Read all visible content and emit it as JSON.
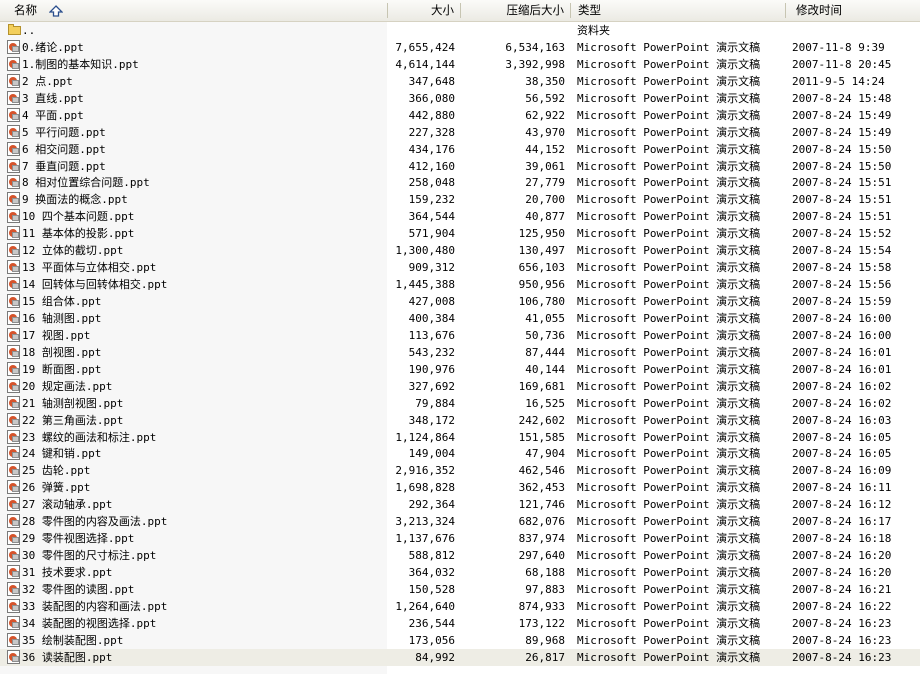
{
  "columns": {
    "name": "名称",
    "size": "大小",
    "compressed": "压缩后大小",
    "type": "类型",
    "modified": "修改时间"
  },
  "parent_row": {
    "name": "..",
    "size": "",
    "compressed": "",
    "type": "资料夹",
    "modified": ""
  },
  "files": [
    {
      "name": "0.绪论.ppt",
      "size": "7,655,424",
      "compressed": "6,534,163",
      "type": "Microsoft PowerPoint 演示文稿",
      "modified": "2007-11-8 9:39"
    },
    {
      "name": "1.制图的基本知识.ppt",
      "size": "4,614,144",
      "compressed": "3,392,998",
      "type": "Microsoft PowerPoint 演示文稿",
      "modified": "2007-11-8 20:45"
    },
    {
      "name": "2 点.ppt",
      "size": "347,648",
      "compressed": "38,350",
      "type": "Microsoft PowerPoint 演示文稿",
      "modified": "2011-9-5 14:24"
    },
    {
      "name": "3 直线.ppt",
      "size": "366,080",
      "compressed": "56,592",
      "type": "Microsoft PowerPoint 演示文稿",
      "modified": "2007-8-24 15:48"
    },
    {
      "name": "4 平面.ppt",
      "size": "442,880",
      "compressed": "62,922",
      "type": "Microsoft PowerPoint 演示文稿",
      "modified": "2007-8-24 15:49"
    },
    {
      "name": "5 平行问题.ppt",
      "size": "227,328",
      "compressed": "43,970",
      "type": "Microsoft PowerPoint 演示文稿",
      "modified": "2007-8-24 15:49"
    },
    {
      "name": "6 相交问题.ppt",
      "size": "434,176",
      "compressed": "44,152",
      "type": "Microsoft PowerPoint 演示文稿",
      "modified": "2007-8-24 15:50"
    },
    {
      "name": "7 垂直问题.ppt",
      "size": "412,160",
      "compressed": "39,061",
      "type": "Microsoft PowerPoint 演示文稿",
      "modified": "2007-8-24 15:50"
    },
    {
      "name": "8 相对位置综合问题.ppt",
      "size": "258,048",
      "compressed": "27,779",
      "type": "Microsoft PowerPoint 演示文稿",
      "modified": "2007-8-24 15:51"
    },
    {
      "name": "9 换面法的概念.ppt",
      "size": "159,232",
      "compressed": "20,700",
      "type": "Microsoft PowerPoint 演示文稿",
      "modified": "2007-8-24 15:51"
    },
    {
      "name": "10 四个基本问题.ppt",
      "size": "364,544",
      "compressed": "40,877",
      "type": "Microsoft PowerPoint 演示文稿",
      "modified": "2007-8-24 15:51"
    },
    {
      "name": "11 基本体的投影.ppt",
      "size": "571,904",
      "compressed": "125,950",
      "type": "Microsoft PowerPoint 演示文稿",
      "modified": "2007-8-24 15:52"
    },
    {
      "name": "12 立体的截切.ppt",
      "size": "1,300,480",
      "compressed": "130,497",
      "type": "Microsoft PowerPoint 演示文稿",
      "modified": "2007-8-24 15:54"
    },
    {
      "name": "13 平面体与立体相交.ppt",
      "size": "909,312",
      "compressed": "656,103",
      "type": "Microsoft PowerPoint 演示文稿",
      "modified": "2007-8-24 15:58"
    },
    {
      "name": "14 回转体与回转体相交.ppt",
      "size": "1,445,388",
      "compressed": "950,956",
      "type": "Microsoft PowerPoint 演示文稿",
      "modified": "2007-8-24 15:56"
    },
    {
      "name": "15 组合体.ppt",
      "size": "427,008",
      "compressed": "106,780",
      "type": "Microsoft PowerPoint 演示文稿",
      "modified": "2007-8-24 15:59"
    },
    {
      "name": "16 轴测图.ppt",
      "size": "400,384",
      "compressed": "41,055",
      "type": "Microsoft PowerPoint 演示文稿",
      "modified": "2007-8-24 16:00"
    },
    {
      "name": "17 视图.ppt",
      "size": "113,676",
      "compressed": "50,736",
      "type": "Microsoft PowerPoint 演示文稿",
      "modified": "2007-8-24 16:00"
    },
    {
      "name": "18 剖视图.ppt",
      "size": "543,232",
      "compressed": "87,444",
      "type": "Microsoft PowerPoint 演示文稿",
      "modified": "2007-8-24 16:01"
    },
    {
      "name": "19 断面图.ppt",
      "size": "190,976",
      "compressed": "40,144",
      "type": "Microsoft PowerPoint 演示文稿",
      "modified": "2007-8-24 16:01"
    },
    {
      "name": "20 规定画法.ppt",
      "size": "327,692",
      "compressed": "169,681",
      "type": "Microsoft PowerPoint 演示文稿",
      "modified": "2007-8-24 16:02"
    },
    {
      "name": "21 轴测剖视图.ppt",
      "size": "79,884",
      "compressed": "16,525",
      "type": "Microsoft PowerPoint 演示文稿",
      "modified": "2007-8-24 16:02"
    },
    {
      "name": "22 第三角画法.ppt",
      "size": "348,172",
      "compressed": "242,602",
      "type": "Microsoft PowerPoint 演示文稿",
      "modified": "2007-8-24 16:03"
    },
    {
      "name": "23 螺纹的画法和标注.ppt",
      "size": "1,124,864",
      "compressed": "151,585",
      "type": "Microsoft PowerPoint 演示文稿",
      "modified": "2007-8-24 16:05"
    },
    {
      "name": "24 键和销.ppt",
      "size": "149,004",
      "compressed": "47,904",
      "type": "Microsoft PowerPoint 演示文稿",
      "modified": "2007-8-24 16:05"
    },
    {
      "name": "25 齿轮.ppt",
      "size": "2,916,352",
      "compressed": "462,546",
      "type": "Microsoft PowerPoint 演示文稿",
      "modified": "2007-8-24 16:09"
    },
    {
      "name": "26 弹簧.ppt",
      "size": "1,698,828",
      "compressed": "362,453",
      "type": "Microsoft PowerPoint 演示文稿",
      "modified": "2007-8-24 16:11"
    },
    {
      "name": "27 滚动轴承.ppt",
      "size": "292,364",
      "compressed": "121,746",
      "type": "Microsoft PowerPoint 演示文稿",
      "modified": "2007-8-24 16:12"
    },
    {
      "name": "28 零件图的内容及画法.ppt",
      "size": "3,213,324",
      "compressed": "682,076",
      "type": "Microsoft PowerPoint 演示文稿",
      "modified": "2007-8-24 16:17"
    },
    {
      "name": "29 零件视图选择.ppt",
      "size": "1,137,676",
      "compressed": "837,974",
      "type": "Microsoft PowerPoint 演示文稿",
      "modified": "2007-8-24 16:18"
    },
    {
      "name": "30 零件图的尺寸标注.ppt",
      "size": "588,812",
      "compressed": "297,640",
      "type": "Microsoft PowerPoint 演示文稿",
      "modified": "2007-8-24 16:20"
    },
    {
      "name": "31 技术要求.ppt",
      "size": "364,032",
      "compressed": "68,188",
      "type": "Microsoft PowerPoint 演示文稿",
      "modified": "2007-8-24 16:20"
    },
    {
      "name": "32 零件图的读图.ppt",
      "size": "150,528",
      "compressed": "97,883",
      "type": "Microsoft PowerPoint 演示文稿",
      "modified": "2007-8-24 16:21"
    },
    {
      "name": "33 装配图的内容和画法.ppt",
      "size": "1,264,640",
      "compressed": "874,933",
      "type": "Microsoft PowerPoint 演示文稿",
      "modified": "2007-8-24 16:22"
    },
    {
      "name": "34 装配图的视图选择.ppt",
      "size": "236,544",
      "compressed": "173,122",
      "type": "Microsoft PowerPoint 演示文稿",
      "modified": "2007-8-24 16:23"
    },
    {
      "name": "35 绘制装配图.ppt",
      "size": "173,056",
      "compressed": "89,968",
      "type": "Microsoft PowerPoint 演示文稿",
      "modified": "2007-8-24 16:23"
    },
    {
      "name": "36 读装配图.ppt",
      "size": "84,992",
      "compressed": "26,817",
      "type": "Microsoft PowerPoint 演示文稿",
      "modified": "2007-8-24 16:23"
    }
  ],
  "selected_index": 36,
  "icons": {
    "folder": "folder-up-icon",
    "file": "powerpoint-file-icon",
    "sort": "sort-ascending-icon"
  }
}
